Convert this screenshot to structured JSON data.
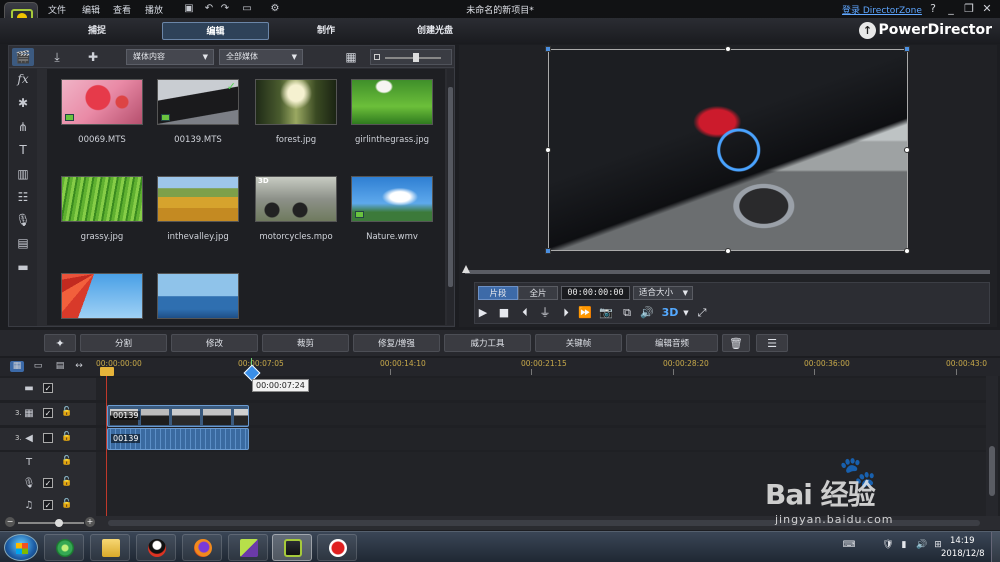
{
  "titlebar": {
    "menu": [
      "文件",
      "编辑",
      "查看",
      "播放"
    ],
    "doc_title": "未命名的新项目*",
    "login": "登录 DirectorZone",
    "window_buttons": [
      "?",
      "_",
      "❐",
      "✕"
    ]
  },
  "modes": {
    "tabs": [
      "捕捉",
      "编辑",
      "制作",
      "创建光盘"
    ],
    "active": "编辑",
    "brand": "PowerDirector"
  },
  "library": {
    "dropdown_content": "媒体内容",
    "dropdown_filter": "全部媒体",
    "items": [
      {
        "label": "00069.MTS",
        "kind": "video",
        "icon": "video-badge"
      },
      {
        "label": "00139.MTS",
        "kind": "video",
        "icon": "video-badge",
        "used": true
      },
      {
        "label": "forest.jpg",
        "kind": "image"
      },
      {
        "label": "girlinthegrass.jpg",
        "kind": "image"
      },
      {
        "label": "grassy.jpg",
        "kind": "image"
      },
      {
        "label": "inthevalley.jpg",
        "kind": "image"
      },
      {
        "label": "motorcycles.mpo",
        "kind": "image",
        "badge": "3D"
      },
      {
        "label": "Nature.wmv",
        "kind": "video",
        "icon": "video-badge"
      },
      {
        "label": "",
        "kind": "image"
      },
      {
        "label": "",
        "kind": "image"
      }
    ]
  },
  "preview": {
    "seg_clip": "片段",
    "seg_movie": "全片",
    "timecode": "00:00:00:00",
    "fit": "适合大小",
    "btn_3d": "3D"
  },
  "edit_toolbar": {
    "buttons": [
      "分割",
      "修改",
      "裁剪",
      "修复/增强",
      "威力工具",
      "关键帧",
      "编辑音频"
    ]
  },
  "timeline": {
    "ticks": [
      "00:00:00:00",
      "00:00:07:05",
      "00:00:14:10",
      "00:00:21:15",
      "00:00:28:20",
      "00:00:36:00",
      "00:00:43:0"
    ],
    "tooltip": "00:00:07:24",
    "tracks": [
      {
        "num": "",
        "icon": "video-track-icon",
        "checked": true
      },
      {
        "num": "3.",
        "icon": "video-track-icon",
        "checked": true
      },
      {
        "num": "3.",
        "icon": "audio-track-icon",
        "checked": false
      },
      {
        "num": "",
        "icon": "title-track-icon",
        "checked": null
      },
      {
        "num": "",
        "icon": "voice-track-icon",
        "checked": true
      },
      {
        "num": "",
        "icon": "music-track-icon",
        "checked": true
      }
    ],
    "video_clip": "00139",
    "audio_clip": "00139"
  },
  "taskbar": {
    "apps": [
      "ie-icon",
      "explorer-icon",
      "qq-icon",
      "firefox-icon",
      "camtasia-icon",
      "powerdirector-icon",
      "recorder-icon"
    ],
    "time": "14:19",
    "date": "2018/12/8"
  },
  "watermark": {
    "text": "Bai 经验",
    "url": "jingyan.baidu.com"
  }
}
